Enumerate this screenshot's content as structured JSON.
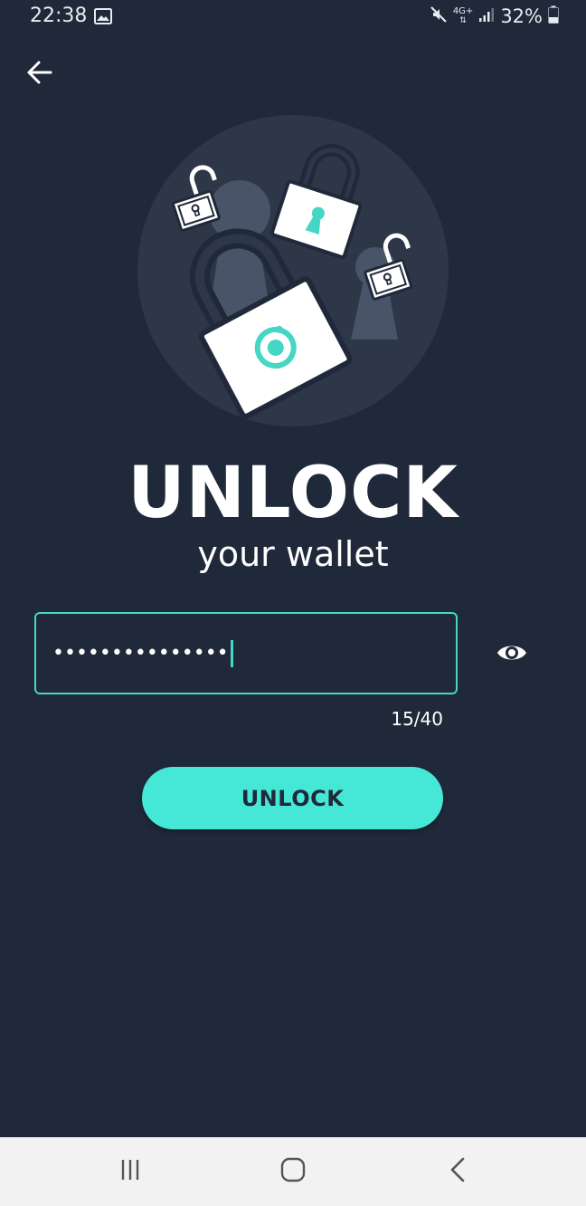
{
  "status_bar": {
    "time": "22:38",
    "network": "4G+",
    "battery": "32%",
    "icons": [
      "gallery-icon",
      "mute-icon",
      "network-4g-icon",
      "signal-icon",
      "battery-icon"
    ]
  },
  "header": {
    "back_icon": "arrow-left-icon"
  },
  "hero": {
    "illustration": "padlocks-illustration"
  },
  "title": "UNLOCK",
  "subtitle": "your wallet",
  "password": {
    "value_masked": "•••••••••••••••",
    "counter": "15/40",
    "toggle_icon": "eye-icon"
  },
  "unlock_button": {
    "label": "UNLOCK"
  },
  "navigation": {
    "icons": [
      "recent-apps-icon",
      "home-icon",
      "back-icon"
    ]
  },
  "colors": {
    "background": "#1f293a",
    "accent": "#45e8d6",
    "hero_circle": "#2d3748",
    "nav_bar": "#f2f2f2"
  }
}
